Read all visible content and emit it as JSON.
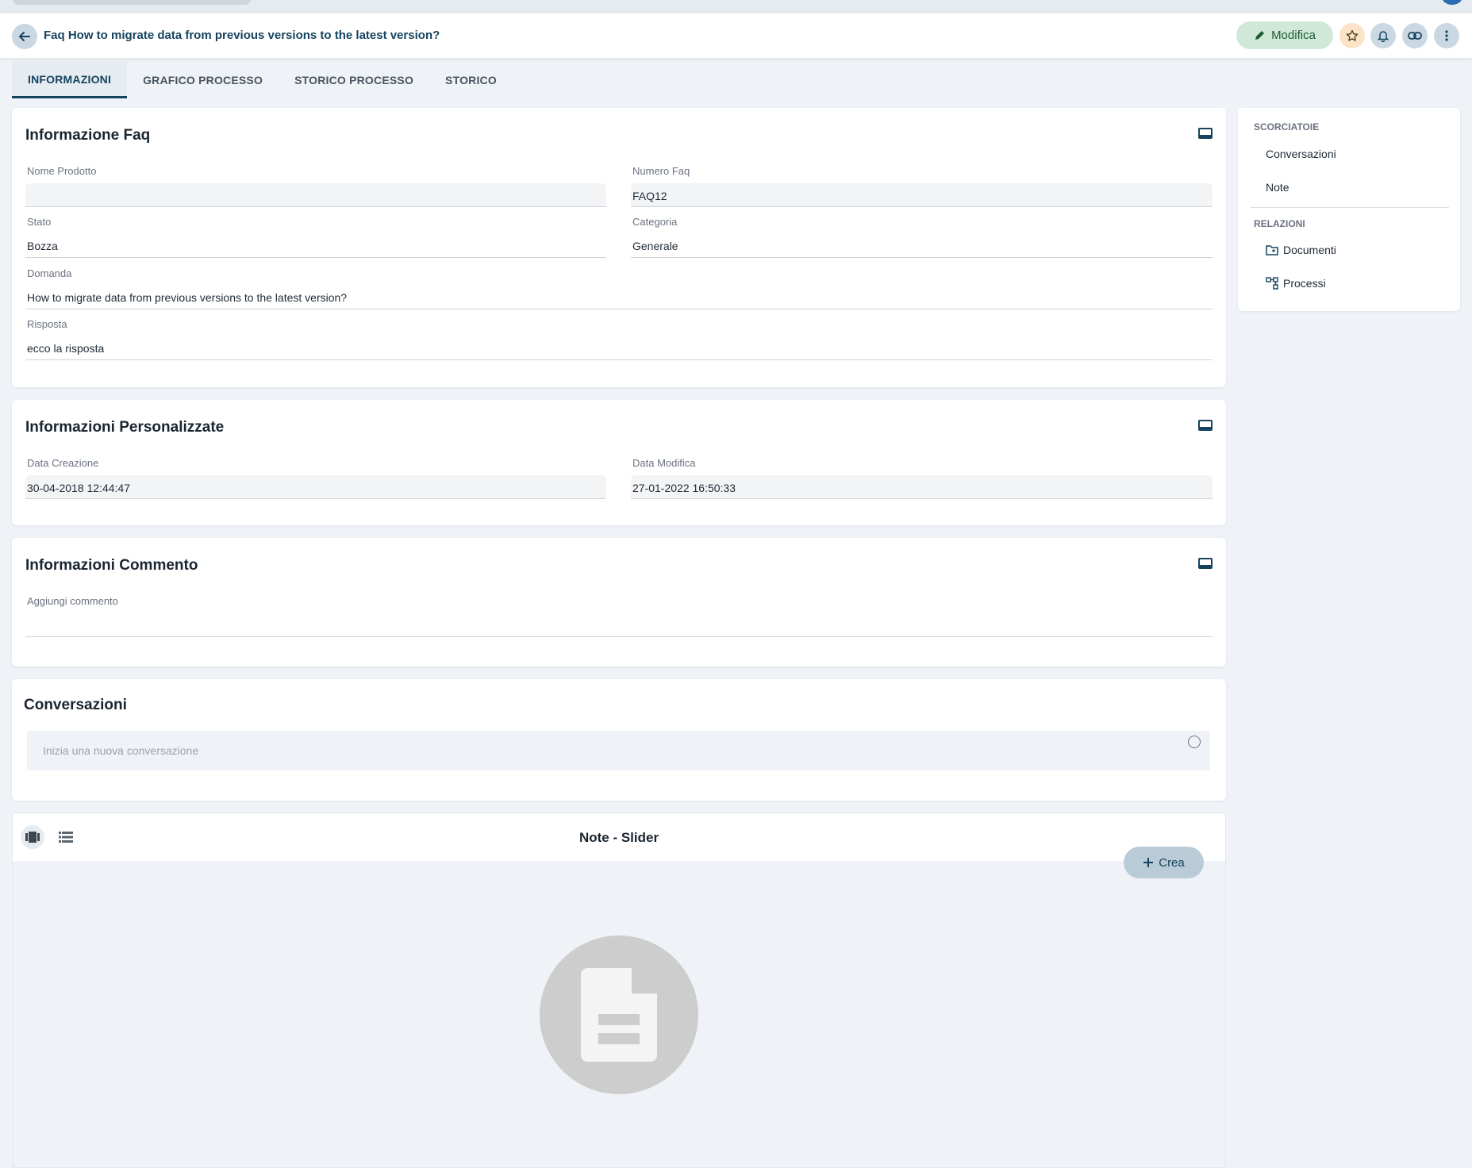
{
  "header": {
    "title": "Faq How to migrate data from previous versions to the latest version?",
    "edit_label": "Modifica"
  },
  "tabs": [
    {
      "label": "INFORMAZIONI"
    },
    {
      "label": "GRAFICO PROCESSO"
    },
    {
      "label": "STORICO PROCESSO"
    },
    {
      "label": "STORICO"
    }
  ],
  "faq_info": {
    "title": "Informazione Faq",
    "product_label": "Nome Prodotto",
    "product_value": "",
    "number_label": "Numero Faq",
    "number_value": "FAQ12",
    "status_label": "Stato",
    "status_value": "Bozza",
    "category_label": "Categoria",
    "category_value": "Generale",
    "question_label": "Domanda",
    "question_value": "How to migrate data from previous versions to the latest version?",
    "answer_label": "Risposta",
    "answer_value": "ecco la risposta"
  },
  "custom_info": {
    "title": "Informazioni Personalizzate",
    "created_label": "Data Creazione",
    "created_value": "30-04-2018 12:44:47",
    "modified_label": "Data Modifica",
    "modified_value": "27-01-2022 16:50:33"
  },
  "comment_info": {
    "title": "Informazioni Commento",
    "add_label": "Aggiungi commento",
    "value": ""
  },
  "conversations": {
    "title": "Conversazioni",
    "placeholder": "Inizia una nuova conversazione"
  },
  "notes": {
    "title": "Note - Slider",
    "create_label": "Crea"
  },
  "sidebar": {
    "shortcuts_heading": "SCORCIATOIE",
    "shortcuts": [
      {
        "label": "Conversazioni"
      },
      {
        "label": "Note"
      }
    ],
    "relations_heading": "RELAZIONI",
    "relations": [
      {
        "label": "Documenti",
        "icon": "folder-icon"
      },
      {
        "label": "Processi",
        "icon": "process-icon"
      }
    ]
  },
  "colors": {
    "primary": "#15435f",
    "edit_bg": "#cfe8d7",
    "star_bg": "#fce3c7",
    "background": "#eff2f6"
  }
}
